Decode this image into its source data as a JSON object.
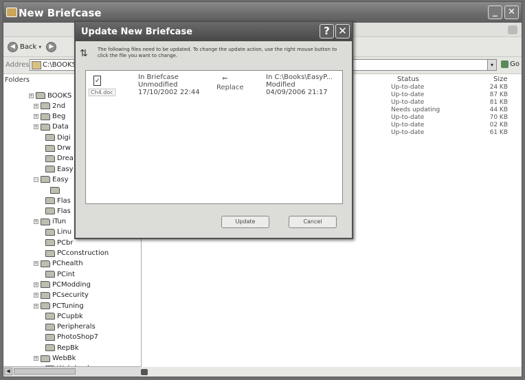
{
  "window": {
    "title": "New Briefcase"
  },
  "toolbar": {
    "back_label": "Back"
  },
  "address": {
    "label": "Address",
    "value": "C:\\BOOKS\\New Briefcase",
    "go_label": "Go"
  },
  "folders": {
    "header": "Folders",
    "items": [
      {
        "label": "BOOKS"
      },
      {
        "label": "2nd"
      },
      {
        "label": "Beg"
      },
      {
        "label": "Data"
      },
      {
        "label": "Digi"
      },
      {
        "label": "Drw"
      },
      {
        "label": "Drea"
      },
      {
        "label": "Easy"
      },
      {
        "label": "Easy"
      },
      {
        "label": ""
      },
      {
        "label": "Flas"
      },
      {
        "label": "Flas"
      },
      {
        "label": "iTun"
      },
      {
        "label": "Linu"
      },
      {
        "label": "PCbr"
      },
      {
        "label": "PCconstruction"
      },
      {
        "label": "PChealth"
      },
      {
        "label": "PCint"
      },
      {
        "label": "PCModding"
      },
      {
        "label": "PCsecurity"
      },
      {
        "label": "PCTuning"
      },
      {
        "label": "PCupbk"
      },
      {
        "label": "Peripherals"
      },
      {
        "label": "PhotoShop7"
      },
      {
        "label": "RepBk"
      },
      {
        "label": "WebBk"
      },
      {
        "label": "Web-book"
      }
    ]
  },
  "details": {
    "col_status": "Status",
    "col_size": "Size",
    "rows": [
      {
        "status": "Up-to-date",
        "size": "24 KB"
      },
      {
        "status": "Up-to-date",
        "size": "87 KB"
      },
      {
        "status": "Up-to-date",
        "size": "81 KB"
      },
      {
        "status": "Needs updating",
        "size": "44 KB"
      },
      {
        "status": "Up-to-date",
        "size": "70 KB"
      },
      {
        "status": "Up-to-date",
        "size": "02 KB"
      },
      {
        "status": "Up-to-date",
        "size": "61 KB"
      }
    ]
  },
  "dialog": {
    "title": "Update New Briefcase",
    "help_glyph": "?",
    "close_glyph": "✕",
    "message": "The following files need to be updated. To change the update action, use the right mouse button to click the file you want to change.",
    "file": {
      "name": "Ch4.doc",
      "left_location": "In Briefcase",
      "left_state": "Unmodified",
      "left_date": "17/10/2002 22:44",
      "action": "Replace",
      "right_location": "In C:\\Books\\EasyP...",
      "right_state": "Modified",
      "right_date": "04/09/2006 21:17"
    },
    "update_label": "Update",
    "cancel_label": "Cancel"
  }
}
